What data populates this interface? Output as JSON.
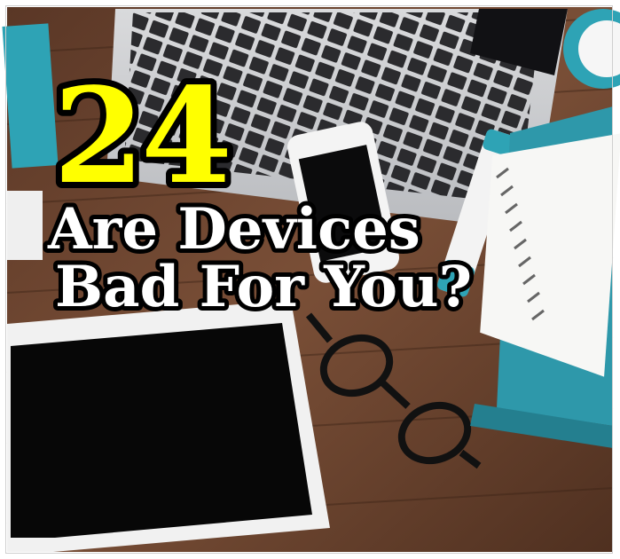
{
  "feature": {
    "number": "24",
    "title_line1": "Are Devices",
    "title_line2": "Bad For You?"
  },
  "colors": {
    "number_fill": "#ffff00",
    "title_fill": "#ffffff",
    "outline": "#000000",
    "wood": "#6b4430",
    "teal": "#2ea3b5"
  },
  "icons": [
    "laptop-icon",
    "smartphone-icon",
    "tablet-icon",
    "glasses-icon",
    "notebook-icon",
    "marker-icon",
    "alarm-clock-icon"
  ]
}
